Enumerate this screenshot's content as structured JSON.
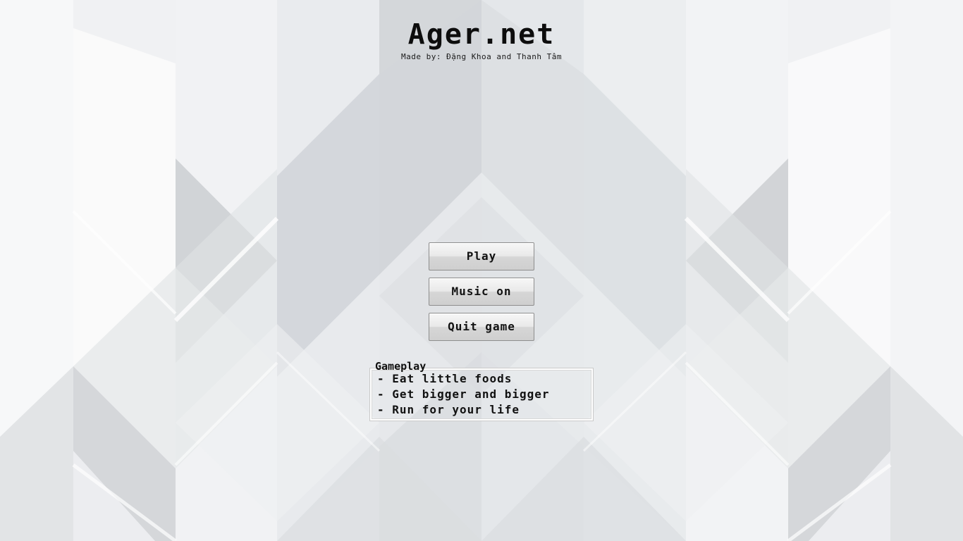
{
  "title": "Ager.net",
  "subtitle": "Made by: Đặng Khoa and Thanh Tâm",
  "menu": {
    "play_label": "Play",
    "music_label": "Music on",
    "quit_label": "Quit game"
  },
  "gameplay": {
    "heading": "Gameplay",
    "lines": [
      "- Eat little foods",
      "- Get bigger and bigger",
      "- Run for your life"
    ]
  },
  "colors": {
    "background": "#eceef1",
    "text": "#111111",
    "button_top": "#f7f7f7",
    "button_bottom": "#cfcfcf"
  }
}
